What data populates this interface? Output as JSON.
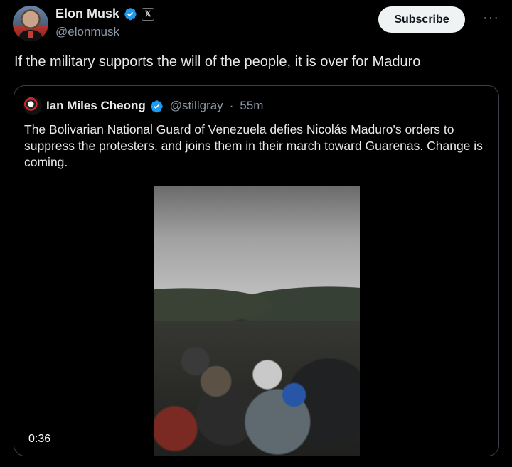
{
  "author": {
    "name": "Elon Musk",
    "handle": "@elonmusk",
    "badge_label": "𝕏"
  },
  "actions": {
    "subscribe_label": "Subscribe",
    "more_label": "···"
  },
  "tweet": {
    "text": "If the military supports the will of the people, it is over for Maduro"
  },
  "quote": {
    "name": "Ian Miles Cheong",
    "handle": "@stillgray",
    "separator": "·",
    "time": "55m",
    "text": "The Bolivarian National Guard of Venezuela defies Nicolás Maduro's orders to suppress the protesters, and joins them in their march toward Guarenas. Change is coming.",
    "video_duration": "0:36"
  },
  "colors": {
    "verified_blue": "#1d9bf0",
    "background": "#000000",
    "text": "#e7e9ea",
    "muted": "#8b98a5"
  },
  "icons": {
    "verified": "verified-badge-icon",
    "more": "more-dots-icon"
  }
}
